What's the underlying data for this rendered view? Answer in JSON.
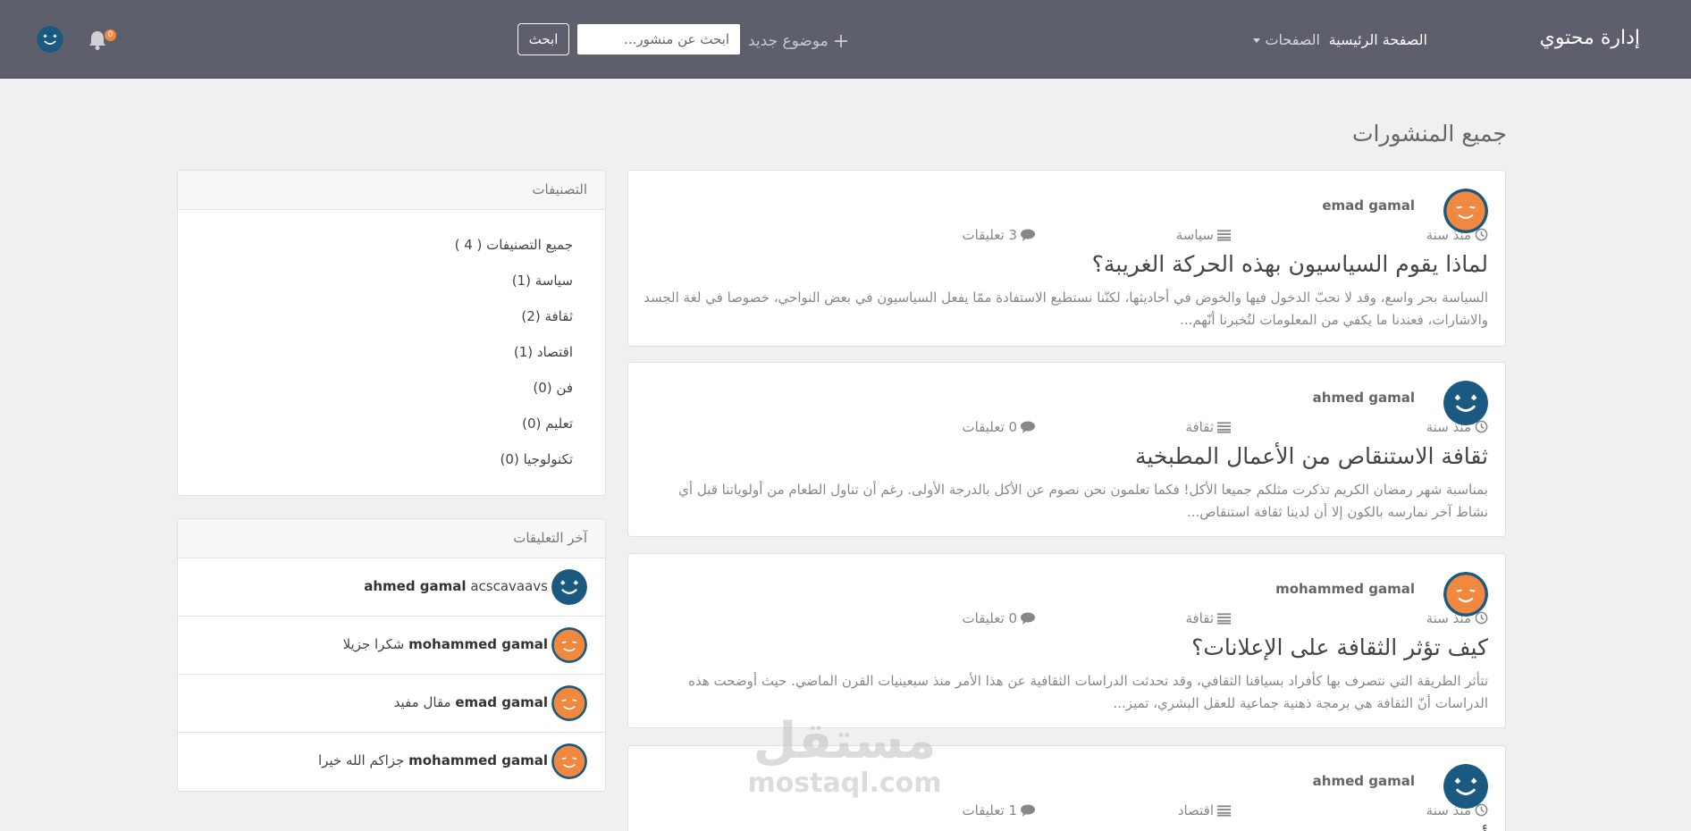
{
  "colors": {
    "navbar_bg": "#5d5f6d",
    "page_bg": "#f0f0f0",
    "avatar_blue": "#1a5a80",
    "avatar_orange": "#f0883f",
    "badge": "#f0883f"
  },
  "navbar": {
    "brand": "إدارة محتوي",
    "home_link": "الصفحة الرئيسية",
    "pages_dropdown": "الصفحات",
    "new_topic": "موضوع جديد",
    "search_placeholder": "ابحث عن منشور...",
    "search_button": "ابحث",
    "notification_count": "0",
    "icons": {
      "new_topic": "plus-icon",
      "notifications": "bell-icon",
      "dropdown": "caret-down-icon"
    }
  },
  "main": {
    "heading": "جميع المنشورات",
    "posts": [
      {
        "author": "emad gamal",
        "avatar_style": "orange",
        "time": "منذ سنة",
        "category": "سياسة",
        "comments": "3 تعليقات",
        "title": "لماذا يقوم السياسيون بهذه الحركة الغريبة؟",
        "excerpt": "السياسة بحر واسع، وقد لا نحبّ الدخول فيها والخوض في أحاديثها، لكنّنا نستطيع الاستفادة ممّا يفعل السياسيون في بعض النواحي، خصوصا في لغة الجسد والاشارات، فعندنا ما يكفي من المعلومات لتُخبرنا أنّهم..."
      },
      {
        "author": "ahmed gamal",
        "avatar_style": "blue",
        "time": "منذ سنة",
        "category": "ثقافة",
        "comments": "0 تعليقات",
        "title": "ثقافة الاستنقاص من الأعمال المطبخية",
        "excerpt": "بمناسبة شهر رمضان الكريم تذكرت مثلكم جميعا الأكل! فكما تعلمون نحن نصوم عن الأكل بالدرجة الأولى. رغم أن تناول الطعام من أولوياتنا قبل أي نشاط آخر نمارسه بالكون إلا أن لدينا ثقافة استنقاص..."
      },
      {
        "author": "mohammed gamal",
        "avatar_style": "orange",
        "time": "منذ سنة",
        "category": "ثقافة",
        "comments": "0 تعليقات",
        "title": "كيف تؤثر الثقافة على الإعلانات؟",
        "excerpt": "تتأثر الطريقة التي نتصرف بها كأفراد بسياقنا الثقافي، وقد تحدثت الدراسات الثقافية عن هذا الأمر منذ سبعينيات القرن الماضي. حيث أوضحت هذه الدراسات أنّ الثقافة هي برمجة ذهنية جماعية للعقل البشري، تميز..."
      },
      {
        "author": "ahmed gamal",
        "avatar_style": "blue",
        "time": "منذ سنة",
        "category": "اقتصاد",
        "comments": "1 تعليقات",
        "title": "أ",
        "excerpt": ""
      }
    ],
    "icons": {
      "time": "clock-icon",
      "category": "list-icon",
      "comments": "comment-icon"
    }
  },
  "sidebar": {
    "categories_title": "التصنيفات",
    "categories": [
      "جميع التصنيفات ( 4 )",
      "سياسة (1)",
      "ثقافة (2)",
      "اقتصاد (1)",
      "فن (0)",
      "تعليم (0)",
      "تكنولوجيا (0)"
    ],
    "comments_title": "آخر التعليقات",
    "recent_comments": [
      {
        "author": "ahmed gamal",
        "text": "acscavaavs",
        "avatar_style": "blue"
      },
      {
        "author": "mohammed gamal",
        "text": "شكرا جزيلا",
        "avatar_style": "orange"
      },
      {
        "author": "emad gamal",
        "text": "مقال مفيد",
        "avatar_style": "orange"
      },
      {
        "author": "mohammed gamal",
        "text": "جزاكم الله خيرا",
        "avatar_style": "orange"
      }
    ]
  },
  "watermark": {
    "arabic": "مستقل",
    "latin": "mostaql.com"
  }
}
